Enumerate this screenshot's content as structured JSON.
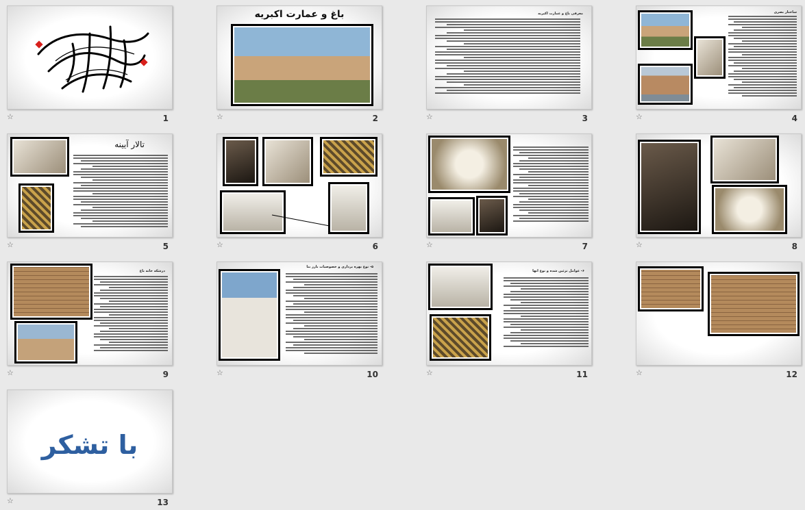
{
  "slides": [
    {
      "number": "1",
      "type": "calligraphy"
    },
    {
      "number": "2",
      "title": "باغ و عمارت اکبریه"
    },
    {
      "number": "3",
      "heading": "معرفی باغ و عمارت اکبریه"
    },
    {
      "number": "4",
      "heading": "ساختار بصری"
    },
    {
      "number": "5",
      "title": "تالار آیینه"
    },
    {
      "number": "6"
    },
    {
      "number": "7"
    },
    {
      "number": "8"
    },
    {
      "number": "9",
      "heading": "درشکه خانه باغ"
    },
    {
      "number": "10",
      "heading": "۵- نوع بهره برداری و خصوصیات بارز بنا"
    },
    {
      "number": "11",
      "heading": "۶- عوامل تزئین شده و نوع آنها"
    },
    {
      "number": "12"
    },
    {
      "number": "13",
      "title": "با تشکر"
    }
  ],
  "colors": {
    "title_blue": "#2e5fa0",
    "calligraphy_red": "#d8201c",
    "frame": "#000000"
  },
  "icons": {
    "slide_marker": "star-icon"
  }
}
